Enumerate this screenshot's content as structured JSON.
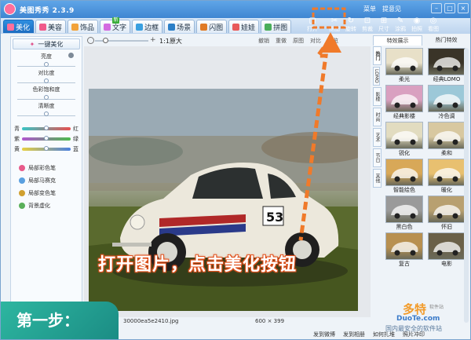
{
  "app": {
    "title": "美图秀秀 2.3.9",
    "top_links": [
      "菜单",
      "提意见"
    ]
  },
  "tabs": [
    {
      "label": "美化",
      "active": true,
      "color": "#ff6f9c"
    },
    {
      "label": "美容",
      "active": false,
      "color": "#f05a8a"
    },
    {
      "label": "饰品",
      "active": false,
      "color": "#f2a33a"
    },
    {
      "label": "文字",
      "active": false,
      "color": "#d36ae0"
    },
    {
      "label": "边框",
      "active": false,
      "color": "#3aa0e0"
    },
    {
      "label": "场景",
      "active": false,
      "color": "#2c7fc7"
    },
    {
      "label": "闪图",
      "active": false,
      "color": "#e07b26"
    },
    {
      "label": "娃娃",
      "active": false,
      "color": "#e85a5a"
    },
    {
      "label": "拼图",
      "active": false,
      "color": "#4aae5a"
    }
  ],
  "new_badge": "新",
  "right_tools": [
    {
      "label": "打开",
      "glyph": "▢"
    },
    {
      "label": "抠图",
      "glyph": "✂"
    },
    {
      "label": "旋转",
      "glyph": "↻"
    },
    {
      "label": "剪裁",
      "glyph": "⊡"
    },
    {
      "label": "尺寸",
      "glyph": "⊞"
    },
    {
      "label": "涂鸦",
      "glyph": "✎"
    },
    {
      "label": "拍照",
      "glyph": "◉"
    },
    {
      "label": "看图",
      "glyph": "◎"
    }
  ],
  "left_panel": {
    "onekey_label": "一键美化",
    "sliders": [
      {
        "label": "亮度",
        "value": 0.5
      },
      {
        "label": "对比度",
        "value": 0.5
      },
      {
        "label": "色彩饱和度",
        "value": 0.5
      },
      {
        "label": "清晰度",
        "value": 0.5
      }
    ],
    "color_rows": [
      {
        "left": "青",
        "right": "红",
        "value": 0.5,
        "gradient": "linear-gradient(90deg,#39c5c5,#e85050)"
      },
      {
        "left": "紫",
        "right": "绿",
        "value": 0.5,
        "gradient": "linear-gradient(90deg,#b155d0,#4cbc4c)"
      },
      {
        "left": "黄",
        "right": "蓝",
        "value": 0.5,
        "gradient": "linear-gradient(90deg,#e8d040,#4a80e0)"
      }
    ],
    "features": [
      {
        "label": "局部彩色笔",
        "color": "#e85a8a"
      },
      {
        "label": "局部马赛克",
        "color": "#5aa0e0"
      },
      {
        "label": "局部变色笔",
        "color": "#d0a030"
      },
      {
        "label": "背景虚化",
        "color": "#5ab05a"
      }
    ]
  },
  "canvas_toolbar": {
    "zoom_value": "1:1原大",
    "actions": [
      "撤销",
      "重做",
      "原图",
      "对比",
      "预览"
    ]
  },
  "status_bar": {
    "filename": "30000ea5e2410.jpg",
    "size": "600 × 399"
  },
  "right_panel": {
    "tabs": [
      "特效展示",
      "热门特效"
    ],
    "vertical_tabs": [
      "热门",
      "LOMO",
      "影楼",
      "时尚",
      "艺术",
      "节日",
      "其他"
    ],
    "effects": [
      {
        "label": "柔光",
        "tint": "#e8e0c8"
      },
      {
        "label": "经典LOMO",
        "tint": "#3a3428"
      },
      {
        "label": "经典影楼",
        "tint": "#d9a0c0"
      },
      {
        "label": "冷色调",
        "tint": "#9cc8d8"
      },
      {
        "label": "锐化",
        "tint": "#e2dcc0"
      },
      {
        "label": "柔和",
        "tint": "#d8c8a0"
      },
      {
        "label": "智能绘色",
        "tint": "#d8a858"
      },
      {
        "label": "暖化",
        "tint": "#e8c070"
      },
      {
        "label": "黑白色",
        "tint": "#9a9a9a"
      },
      {
        "label": "怀旧",
        "tint": "#b8a070"
      },
      {
        "label": "复古",
        "tint": "#b89050"
      },
      {
        "label": "电影",
        "tint": "#6a6048"
      }
    ]
  },
  "bottom_links": [
    "发到微博",
    "发到相册",
    "如何扎堆",
    "照片冲印"
  ],
  "overlay": {
    "callout_text": "打开图片，点击美化按钮",
    "step_text": "第一步：",
    "arrow_color": "#f07a2a"
  },
  "watermark": {
    "brand": "多特",
    "tag": "软件站",
    "url": "DuoTe.com",
    "slogan": "国内最安全的软件站"
  }
}
